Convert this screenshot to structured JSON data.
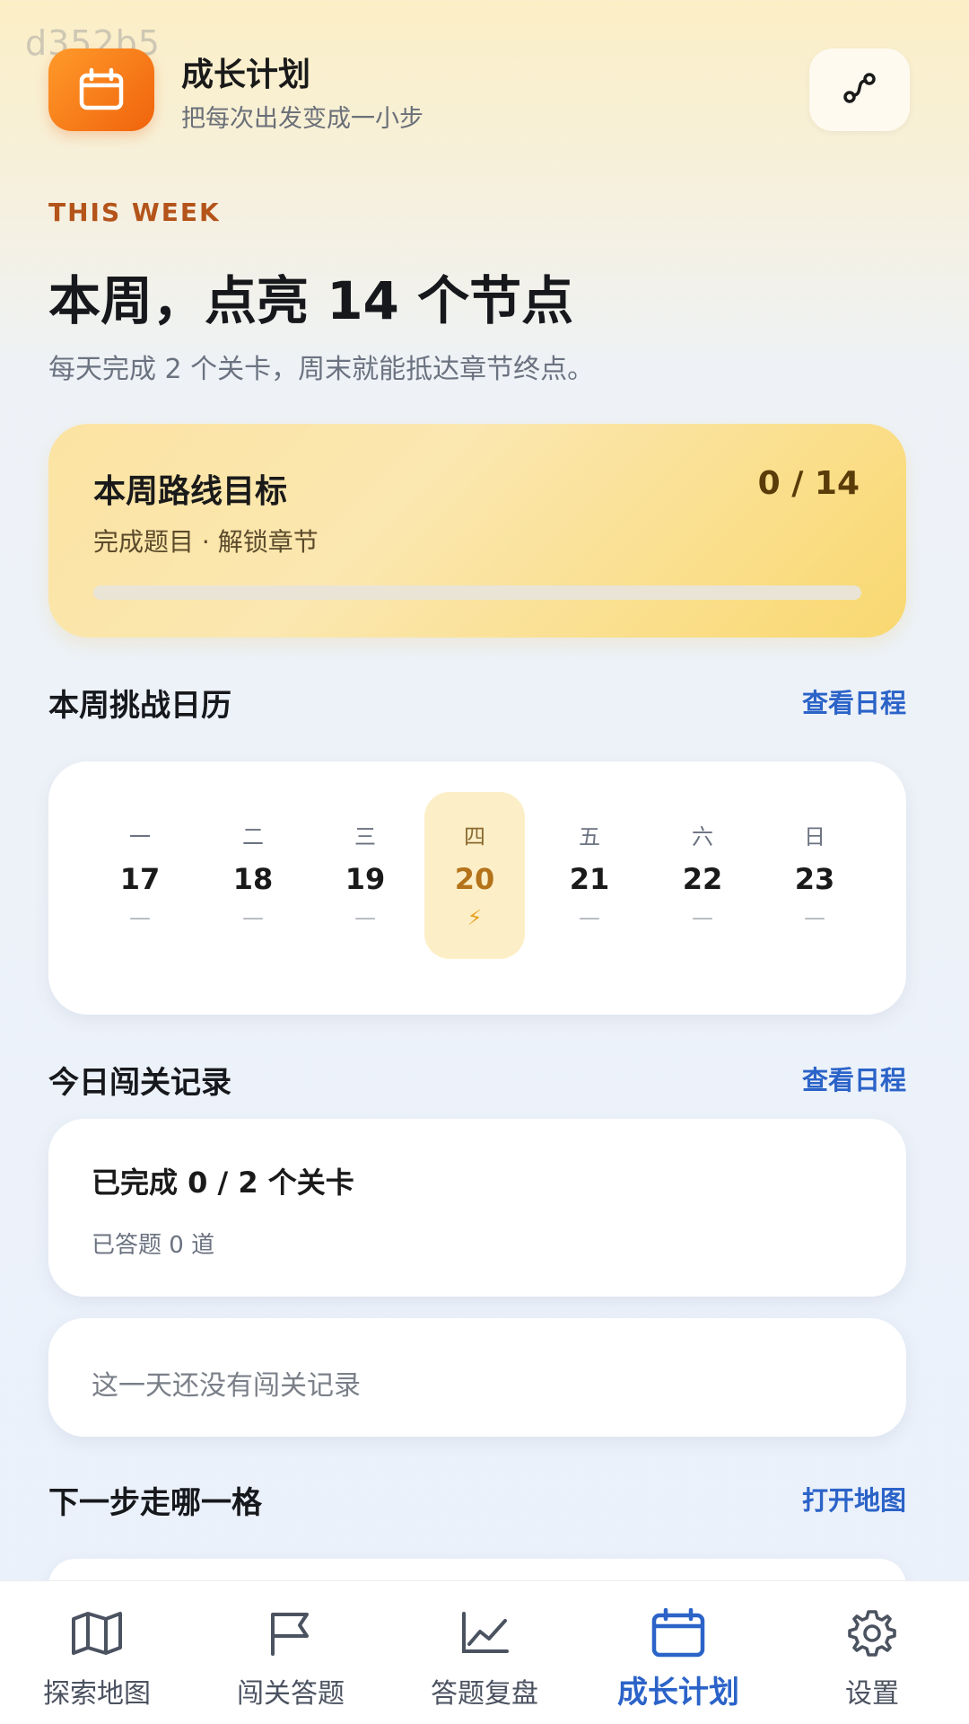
{
  "watermark": "d352b5",
  "header": {
    "title": "成长计划",
    "subtitle": "把每次出发变成一小步",
    "app_icon": "calendar-icon",
    "route_icon": "route-icon"
  },
  "intro": {
    "tag": "THIS WEEK",
    "headline": "本周，点亮 14 个节点",
    "subline": "每天完成 2 个关卡，周末就能抵达章节终点。"
  },
  "goal": {
    "title": "本周路线目标",
    "count": "0 / 14",
    "subtitle": "完成题目 · 解锁章节",
    "progress": 0
  },
  "calendar_section": {
    "title": "本周挑战日历",
    "link": "查看日程"
  },
  "calendar": {
    "days": [
      {
        "weekday": "一",
        "date": "17",
        "mark": "—"
      },
      {
        "weekday": "二",
        "date": "18",
        "mark": "—"
      },
      {
        "weekday": "三",
        "date": "19",
        "mark": "—"
      },
      {
        "weekday": "四",
        "date": "20",
        "mark": "⚡",
        "active": true
      },
      {
        "weekday": "五",
        "date": "21",
        "mark": "—"
      },
      {
        "weekday": "六",
        "date": "22",
        "mark": "—"
      },
      {
        "weekday": "日",
        "date": "23",
        "mark": "—"
      }
    ]
  },
  "record_section": {
    "title": "今日闯关记录",
    "link": "查看日程"
  },
  "record": {
    "title": "已完成 0 / 2 个关卡",
    "subtitle": "已答题 0 道",
    "empty": "这一天还没有闯关记录"
  },
  "next_section": {
    "title": "下一步走哪一格",
    "link": "打开地图"
  },
  "nav": {
    "items": [
      {
        "label": "探索地图",
        "icon": "map-icon"
      },
      {
        "label": "闯关答题",
        "icon": "flag-icon"
      },
      {
        "label": "答题复盘",
        "icon": "chart-icon"
      },
      {
        "label": "成长计划",
        "icon": "calendar-icon",
        "active": true
      },
      {
        "label": "设置",
        "icon": "gear-icon"
      }
    ]
  },
  "colors": {
    "accent_orange": "#f0630c",
    "link_blue": "#2b63c8",
    "active_day_bg": "#fcefc8",
    "goal_card": "#fbe3a2"
  }
}
